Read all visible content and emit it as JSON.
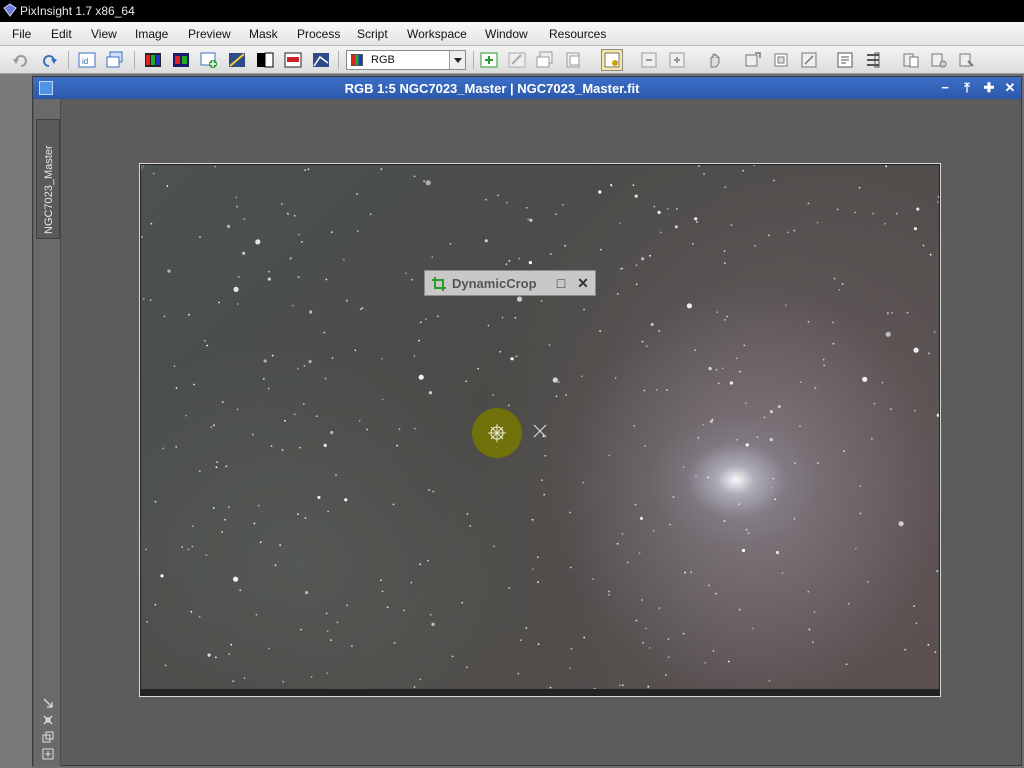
{
  "app": {
    "title": "PixInsight 1.7 x86_64"
  },
  "menu": [
    "File",
    "Edit",
    "View",
    "Image",
    "Preview",
    "Mask",
    "Process",
    "Script",
    "Workspace",
    "Window",
    "Resources"
  ],
  "toolbar": {
    "channel_select": "RGB"
  },
  "document": {
    "title": "RGB 1:5 NGC7023_Master | NGC7023_Master.fit",
    "view_tab": "NGC7023_Master"
  },
  "dynamic_crop": {
    "title": "DynamicCrop"
  },
  "colors": {
    "titlebar_blue": "#2b58ab",
    "cursor_halo": "#787800"
  }
}
